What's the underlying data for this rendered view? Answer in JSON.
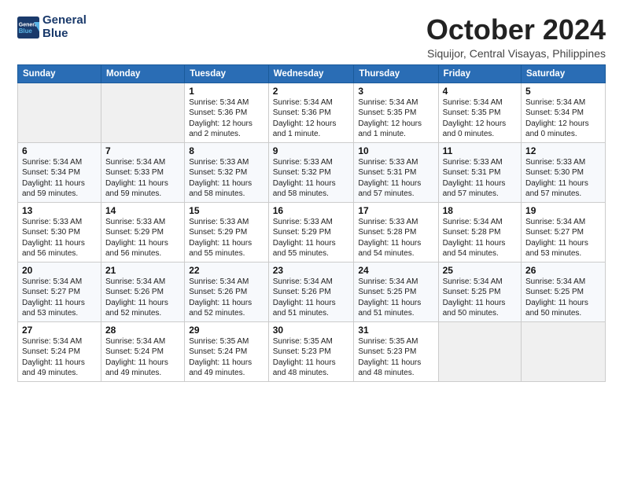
{
  "header": {
    "logo_line1": "General",
    "logo_line2": "Blue",
    "month": "October 2024",
    "location": "Siquijor, Central Visayas, Philippines"
  },
  "weekdays": [
    "Sunday",
    "Monday",
    "Tuesday",
    "Wednesday",
    "Thursday",
    "Friday",
    "Saturday"
  ],
  "weeks": [
    [
      {
        "day": "",
        "empty": true
      },
      {
        "day": "",
        "empty": true
      },
      {
        "day": "1",
        "sunrise": "Sunrise: 5:34 AM",
        "sunset": "Sunset: 5:36 PM",
        "daylight": "Daylight: 12 hours and 2 minutes."
      },
      {
        "day": "2",
        "sunrise": "Sunrise: 5:34 AM",
        "sunset": "Sunset: 5:36 PM",
        "daylight": "Daylight: 12 hours and 1 minute."
      },
      {
        "day": "3",
        "sunrise": "Sunrise: 5:34 AM",
        "sunset": "Sunset: 5:35 PM",
        "daylight": "Daylight: 12 hours and 1 minute."
      },
      {
        "day": "4",
        "sunrise": "Sunrise: 5:34 AM",
        "sunset": "Sunset: 5:35 PM",
        "daylight": "Daylight: 12 hours and 0 minutes."
      },
      {
        "day": "5",
        "sunrise": "Sunrise: 5:34 AM",
        "sunset": "Sunset: 5:34 PM",
        "daylight": "Daylight: 12 hours and 0 minutes."
      }
    ],
    [
      {
        "day": "6",
        "sunrise": "Sunrise: 5:34 AM",
        "sunset": "Sunset: 5:34 PM",
        "daylight": "Daylight: 11 hours and 59 minutes."
      },
      {
        "day": "7",
        "sunrise": "Sunrise: 5:34 AM",
        "sunset": "Sunset: 5:33 PM",
        "daylight": "Daylight: 11 hours and 59 minutes."
      },
      {
        "day": "8",
        "sunrise": "Sunrise: 5:33 AM",
        "sunset": "Sunset: 5:32 PM",
        "daylight": "Daylight: 11 hours and 58 minutes."
      },
      {
        "day": "9",
        "sunrise": "Sunrise: 5:33 AM",
        "sunset": "Sunset: 5:32 PM",
        "daylight": "Daylight: 11 hours and 58 minutes."
      },
      {
        "day": "10",
        "sunrise": "Sunrise: 5:33 AM",
        "sunset": "Sunset: 5:31 PM",
        "daylight": "Daylight: 11 hours and 57 minutes."
      },
      {
        "day": "11",
        "sunrise": "Sunrise: 5:33 AM",
        "sunset": "Sunset: 5:31 PM",
        "daylight": "Daylight: 11 hours and 57 minutes."
      },
      {
        "day": "12",
        "sunrise": "Sunrise: 5:33 AM",
        "sunset": "Sunset: 5:30 PM",
        "daylight": "Daylight: 11 hours and 57 minutes."
      }
    ],
    [
      {
        "day": "13",
        "sunrise": "Sunrise: 5:33 AM",
        "sunset": "Sunset: 5:30 PM",
        "daylight": "Daylight: 11 hours and 56 minutes."
      },
      {
        "day": "14",
        "sunrise": "Sunrise: 5:33 AM",
        "sunset": "Sunset: 5:29 PM",
        "daylight": "Daylight: 11 hours and 56 minutes."
      },
      {
        "day": "15",
        "sunrise": "Sunrise: 5:33 AM",
        "sunset": "Sunset: 5:29 PM",
        "daylight": "Daylight: 11 hours and 55 minutes."
      },
      {
        "day": "16",
        "sunrise": "Sunrise: 5:33 AM",
        "sunset": "Sunset: 5:29 PM",
        "daylight": "Daylight: 11 hours and 55 minutes."
      },
      {
        "day": "17",
        "sunrise": "Sunrise: 5:33 AM",
        "sunset": "Sunset: 5:28 PM",
        "daylight": "Daylight: 11 hours and 54 minutes."
      },
      {
        "day": "18",
        "sunrise": "Sunrise: 5:34 AM",
        "sunset": "Sunset: 5:28 PM",
        "daylight": "Daylight: 11 hours and 54 minutes."
      },
      {
        "day": "19",
        "sunrise": "Sunrise: 5:34 AM",
        "sunset": "Sunset: 5:27 PM",
        "daylight": "Daylight: 11 hours and 53 minutes."
      }
    ],
    [
      {
        "day": "20",
        "sunrise": "Sunrise: 5:34 AM",
        "sunset": "Sunset: 5:27 PM",
        "daylight": "Daylight: 11 hours and 53 minutes."
      },
      {
        "day": "21",
        "sunrise": "Sunrise: 5:34 AM",
        "sunset": "Sunset: 5:26 PM",
        "daylight": "Daylight: 11 hours and 52 minutes."
      },
      {
        "day": "22",
        "sunrise": "Sunrise: 5:34 AM",
        "sunset": "Sunset: 5:26 PM",
        "daylight": "Daylight: 11 hours and 52 minutes."
      },
      {
        "day": "23",
        "sunrise": "Sunrise: 5:34 AM",
        "sunset": "Sunset: 5:26 PM",
        "daylight": "Daylight: 11 hours and 51 minutes."
      },
      {
        "day": "24",
        "sunrise": "Sunrise: 5:34 AM",
        "sunset": "Sunset: 5:25 PM",
        "daylight": "Daylight: 11 hours and 51 minutes."
      },
      {
        "day": "25",
        "sunrise": "Sunrise: 5:34 AM",
        "sunset": "Sunset: 5:25 PM",
        "daylight": "Daylight: 11 hours and 50 minutes."
      },
      {
        "day": "26",
        "sunrise": "Sunrise: 5:34 AM",
        "sunset": "Sunset: 5:25 PM",
        "daylight": "Daylight: 11 hours and 50 minutes."
      }
    ],
    [
      {
        "day": "27",
        "sunrise": "Sunrise: 5:34 AM",
        "sunset": "Sunset: 5:24 PM",
        "daylight": "Daylight: 11 hours and 49 minutes."
      },
      {
        "day": "28",
        "sunrise": "Sunrise: 5:34 AM",
        "sunset": "Sunset: 5:24 PM",
        "daylight": "Daylight: 11 hours and 49 minutes."
      },
      {
        "day": "29",
        "sunrise": "Sunrise: 5:35 AM",
        "sunset": "Sunset: 5:24 PM",
        "daylight": "Daylight: 11 hours and 49 minutes."
      },
      {
        "day": "30",
        "sunrise": "Sunrise: 5:35 AM",
        "sunset": "Sunset: 5:23 PM",
        "daylight": "Daylight: 11 hours and 48 minutes."
      },
      {
        "day": "31",
        "sunrise": "Sunrise: 5:35 AM",
        "sunset": "Sunset: 5:23 PM",
        "daylight": "Daylight: 11 hours and 48 minutes."
      },
      {
        "day": "",
        "empty": true
      },
      {
        "day": "",
        "empty": true
      }
    ]
  ]
}
